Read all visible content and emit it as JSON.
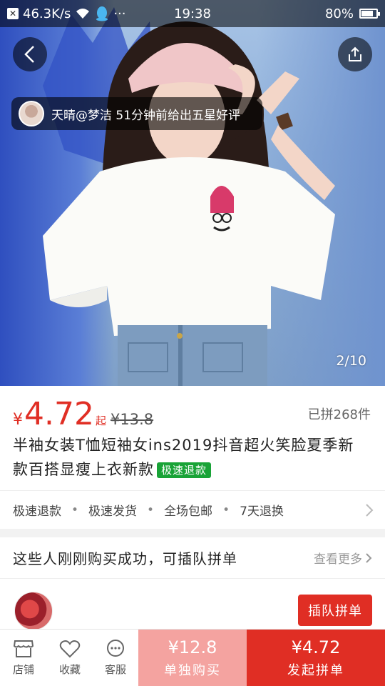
{
  "status_bar": {
    "net_speed": "46.3K/s",
    "time": "19:38",
    "battery": "80%",
    "battery_level": 0.8,
    "icons": [
      "close-x-icon",
      "wifi-icon",
      "qq-icon",
      "more-dots-icon",
      "battery-icon"
    ]
  },
  "hero": {
    "toast_text": "天晴@梦洁 51分钟前给出五星好评",
    "page_indicator": "2/10"
  },
  "product": {
    "currency": "¥",
    "price": "4.72",
    "price_suffix": "起",
    "original_price": "¥13.8",
    "sold_count": "已拼268件",
    "title": "半袖女装T恤短袖女ins2019抖音超火笑脸夏季新款百搭显瘦上衣新款",
    "title_tag": "极速退款",
    "services": [
      "极速退款",
      "极速发货",
      "全场包邮",
      "7天退换"
    ]
  },
  "group_buy": {
    "heading": "这些人刚刚购买成功，可插队拼单",
    "more_label": "查看更多",
    "join_button": "插队拼单"
  },
  "bottom_bar": {
    "nav": [
      {
        "label": "店铺",
        "icon": "store-icon"
      },
      {
        "label": "收藏",
        "icon": "heart-icon"
      },
      {
        "label": "客服",
        "icon": "chat-icon"
      }
    ],
    "buy_alone_price": "¥12.8",
    "buy_alone_label": "单独购买",
    "buy_group_price": "¥4.72",
    "buy_group_label": "发起拼单"
  },
  "colors": {
    "accent_red": "#e02e24",
    "light_red": "#f4a3a0",
    "tag_green": "#19a337"
  }
}
